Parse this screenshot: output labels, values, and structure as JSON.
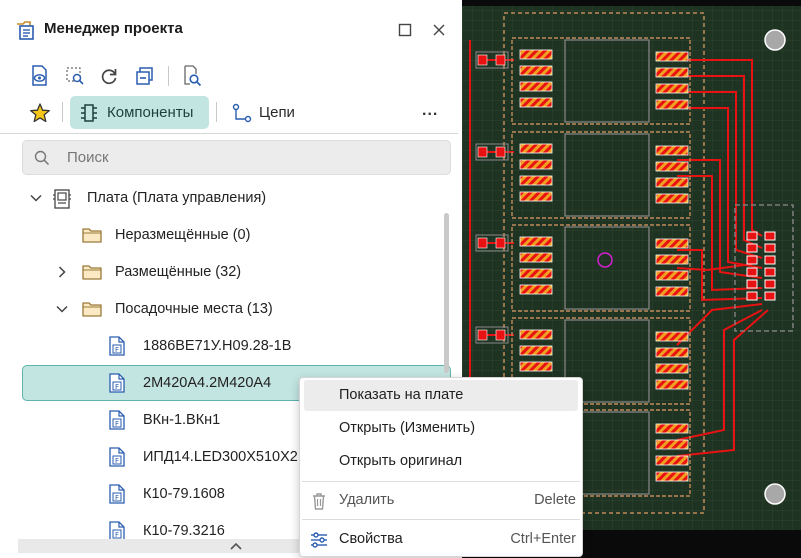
{
  "panel": {
    "title": "Менеджер проекта",
    "icons": [
      "project-manager-icon",
      "maximize-icon",
      "close-icon"
    ]
  },
  "toolbar": {
    "buttons": [
      "show-on-board-icon",
      "select-filter-icon",
      "refresh-icon",
      "collapse-all-icon",
      "find-icon"
    ]
  },
  "tabs": {
    "components_label": "Компоненты",
    "nets_label": "Цепи",
    "more": "..."
  },
  "search": {
    "placeholder": "Поиск"
  },
  "tree": {
    "board": "Плата (Плата управления)",
    "unplaced": "Неразмещённые (0)",
    "placed": "Размещённые (32)",
    "footprints": "Посадочные места (13)",
    "items": [
      "1886ВЕ71У.Н09.28-1В",
      "2М420А4.2М420А4",
      "ВКн-1.ВКн1",
      "ИПД14.LED300X510X2",
      "К10-79.1608",
      "К10-79.3216"
    ]
  },
  "context_menu": {
    "items": [
      {
        "label": "Показать на плате",
        "shortcut": ""
      },
      {
        "label": "Открыть (Изменить)",
        "shortcut": ""
      },
      {
        "label": "Открыть оригинал",
        "shortcut": ""
      },
      {
        "label": "Удалить",
        "shortcut": "Delete"
      },
      {
        "label": "Свойства",
        "shortcut": "Ctrl+Enter"
      }
    ]
  },
  "colors": {
    "accent": "#c3e5e2",
    "accent_border": "#5fb3ad",
    "pcb_board": "#1f3322",
    "pcb_grid": "#2f4a33",
    "trace": "#e81212",
    "pad_orange": "#f0a020",
    "outline": "#c08a5a",
    "silkscreen": "#8a8a8a"
  }
}
